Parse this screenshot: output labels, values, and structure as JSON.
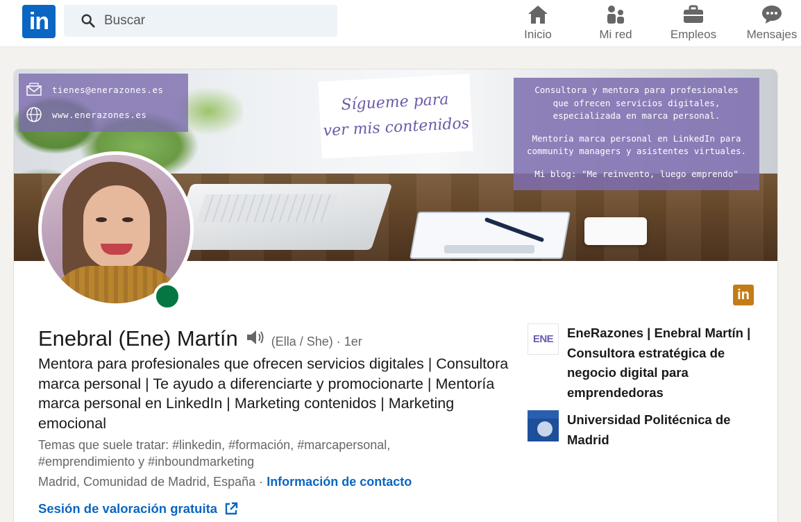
{
  "nav": {
    "logo": "in",
    "search_placeholder": "Buscar",
    "items": [
      {
        "label": "Inicio",
        "icon": "home-icon"
      },
      {
        "label": "Mi red",
        "icon": "network-icon"
      },
      {
        "label": "Empleos",
        "icon": "briefcase-icon"
      },
      {
        "label": "Mensajes",
        "icon": "messages-icon"
      }
    ]
  },
  "banner": {
    "email": "tienes@enerazones.es",
    "website": "www.enerazones.es",
    "follow_text": [
      "Sígueme para",
      "ver mis contenidos"
    ],
    "info_lines": [
      "Consultora y mentora para profesionales",
      "que ofrecen servicios digitales,",
      "especializada en marca personal.",
      "Mentoría marca personal en LinkedIn para",
      "community managers y asistentes virtuales.",
      "Mi blog: \"Me reinvento, luego emprendo\""
    ]
  },
  "profile": {
    "name": "Enebral (Ene) Martín",
    "pronouns": "(Ella / She) · 1er",
    "headline": "Mentora para profesionales que ofrecen servicios digitales | Consultora marca personal | Te ayudo a diferenciarte y promocionarte | Mentoría marca personal en LinkedIn | Marketing contenidos | Marketing emocional",
    "topics": "Temas que suele tratar: #linkedin, #formación, #marcapersonal, #emprendimiento y #inboundmarketing",
    "location": "Madrid, Comunidad de Madrid, España ·",
    "contact_link": "Información de contacto",
    "session_link": "Sesión de valoración gratuita",
    "badge": "in",
    "status": "online"
  },
  "experience": [
    {
      "logo_text": "ENE",
      "name": "EneRazones | Enebral Martín | Consultora estratégica de negocio digital para emprendedoras"
    },
    {
      "logo_text": "",
      "name": "Universidad Politécnica de Madrid"
    }
  ],
  "colors": {
    "linkedin_blue": "#0a66c2",
    "banner_purple": "#7e6eb0",
    "online_green": "#057642",
    "premium_gold": "#c37d16"
  }
}
